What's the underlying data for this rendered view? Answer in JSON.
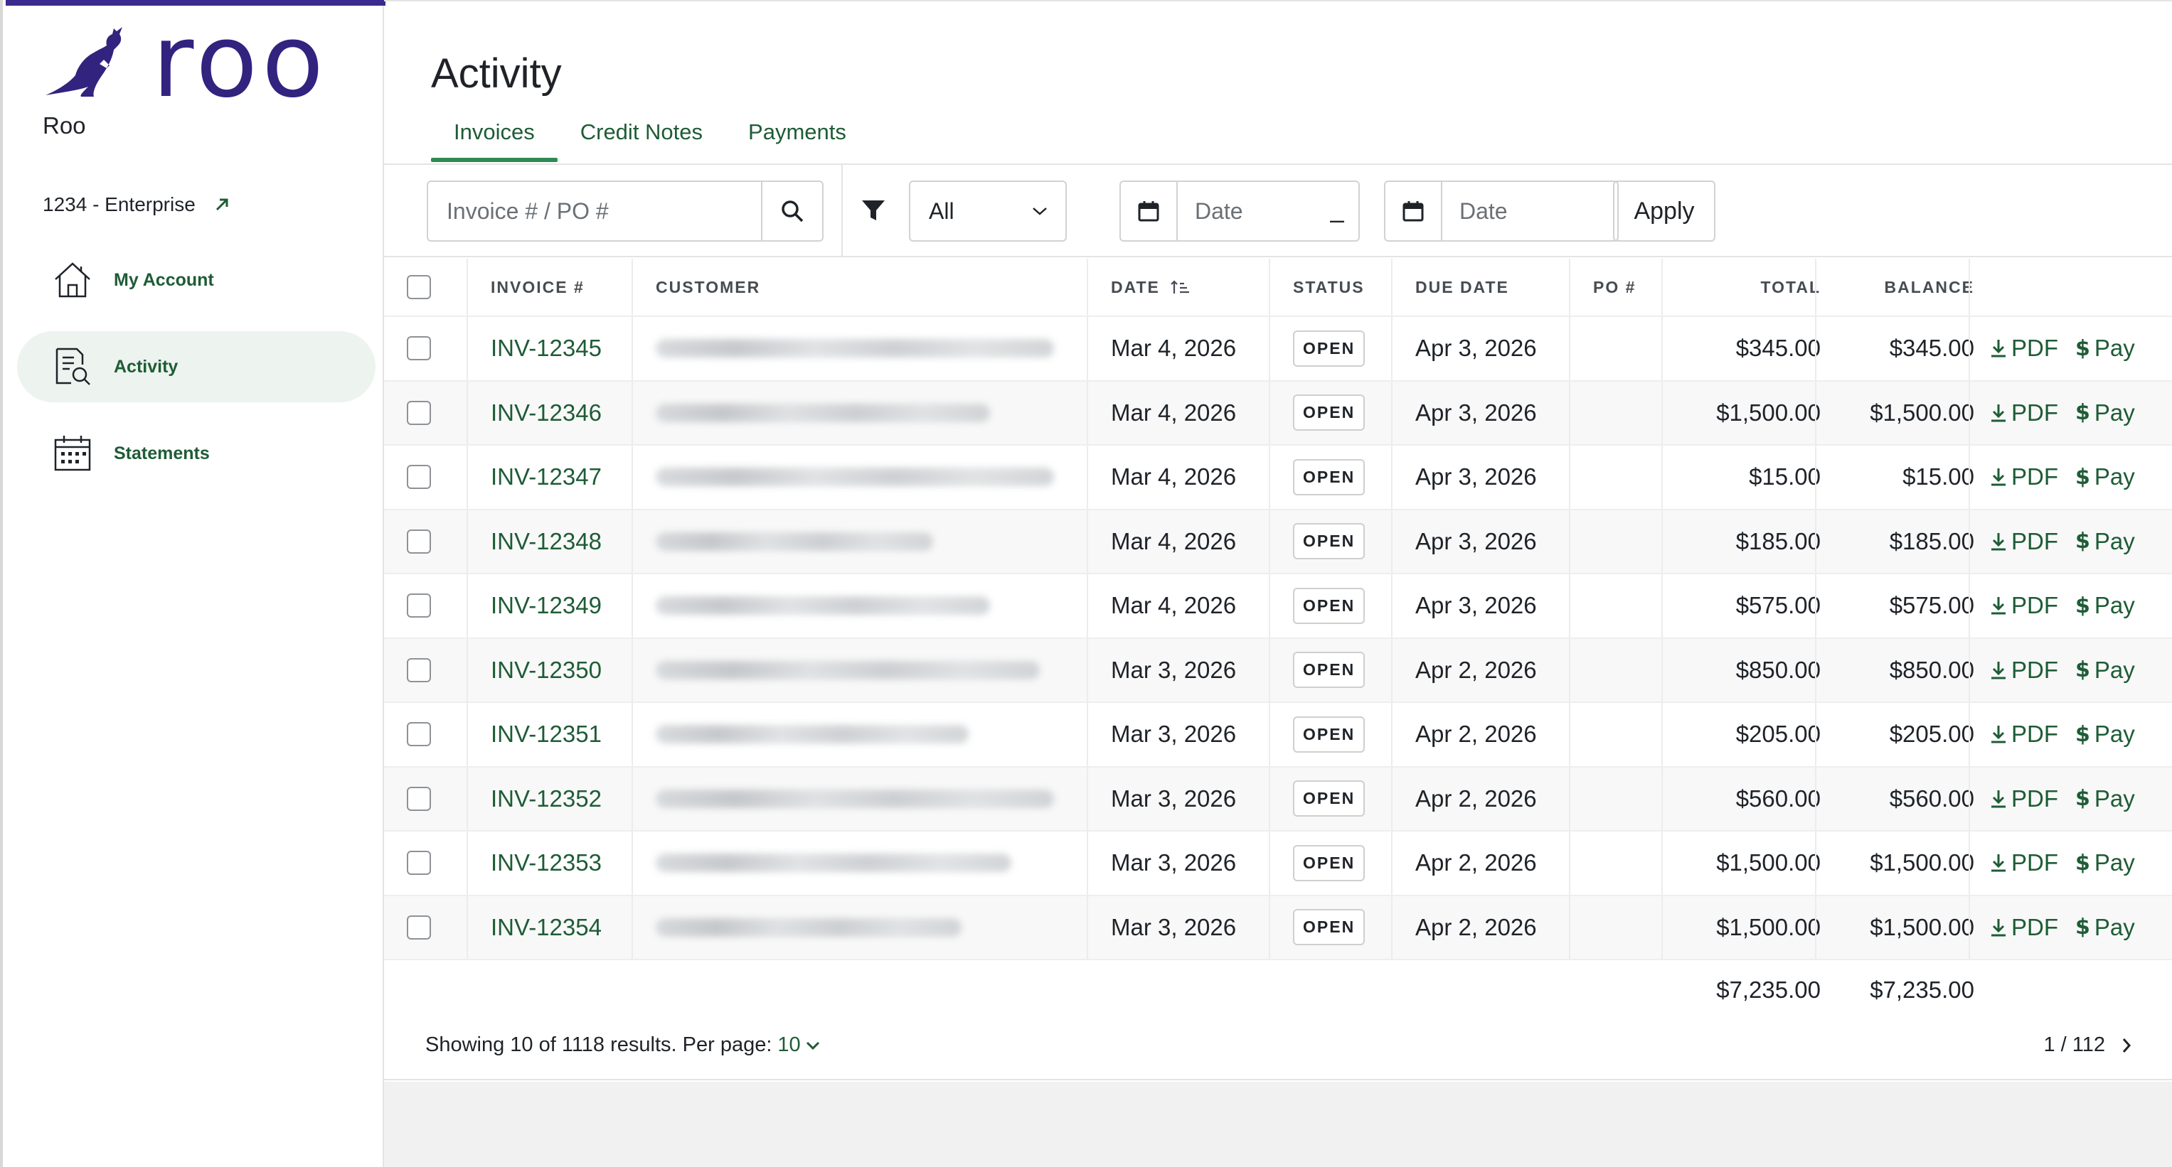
{
  "brand": {
    "logo_text": "roo",
    "org_name": "Roo",
    "account": "1234 - Enterprise",
    "accent": "#3b2a8f",
    "green": "#1e5c36"
  },
  "sidebar": {
    "items": [
      {
        "label": "My Account",
        "icon": "home-icon",
        "active": false
      },
      {
        "label": "Activity",
        "icon": "document-search-icon",
        "active": true
      },
      {
        "label": "Statements",
        "icon": "calendar-icon",
        "active": false
      }
    ]
  },
  "page": {
    "title": "Activity"
  },
  "tabs": [
    {
      "label": "Invoices",
      "active": true
    },
    {
      "label": "Credit Notes",
      "active": false
    },
    {
      "label": "Payments",
      "active": false
    }
  ],
  "filters": {
    "search_placeholder": "Invoice # / PO #",
    "status_selected": "All",
    "date_from_placeholder": "Date",
    "date_to_placeholder": "Date",
    "date_separator": "–",
    "apply_label": "Apply"
  },
  "table": {
    "headers": {
      "invoice": "INVOICE #",
      "customer": "CUSTOMER",
      "date": "DATE",
      "status": "STATUS",
      "due_date": "DUE DATE",
      "po": "PO #",
      "total": "TOTAL",
      "balance": "BALANCE"
    },
    "action_pdf": "PDF",
    "action_pay": "Pay",
    "rows": [
      {
        "invoice": "INV-12345",
        "date": "Mar 4, 2026",
        "status": "OPEN",
        "due": "Apr 3, 2026",
        "po": "",
        "total": "$345.00",
        "balance": "$345.00"
      },
      {
        "invoice": "INV-12346",
        "date": "Mar 4, 2026",
        "status": "OPEN",
        "due": "Apr 3, 2026",
        "po": "",
        "total": "$1,500.00",
        "balance": "$1,500.00"
      },
      {
        "invoice": "INV-12347",
        "date": "Mar 4, 2026",
        "status": "OPEN",
        "due": "Apr 3, 2026",
        "po": "",
        "total": "$15.00",
        "balance": "$15.00"
      },
      {
        "invoice": "INV-12348",
        "date": "Mar 4, 2026",
        "status": "OPEN",
        "due": "Apr 3, 2026",
        "po": "",
        "total": "$185.00",
        "balance": "$185.00"
      },
      {
        "invoice": "INV-12349",
        "date": "Mar 4, 2026",
        "status": "OPEN",
        "due": "Apr 3, 2026",
        "po": "",
        "total": "$575.00",
        "balance": "$575.00"
      },
      {
        "invoice": "INV-12350",
        "date": "Mar 3, 2026",
        "status": "OPEN",
        "due": "Apr 2, 2026",
        "po": "",
        "total": "$850.00",
        "balance": "$850.00"
      },
      {
        "invoice": "INV-12351",
        "date": "Mar 3, 2026",
        "status": "OPEN",
        "due": "Apr 2, 2026",
        "po": "",
        "total": "$205.00",
        "balance": "$205.00"
      },
      {
        "invoice": "INV-12352",
        "date": "Mar 3, 2026",
        "status": "OPEN",
        "due": "Apr 2, 2026",
        "po": "",
        "total": "$560.00",
        "balance": "$560.00"
      },
      {
        "invoice": "INV-12353",
        "date": "Mar 3, 2026",
        "status": "OPEN",
        "due": "Apr 2, 2026",
        "po": "",
        "total": "$1,500.00",
        "balance": "$1,500.00"
      },
      {
        "invoice": "INV-12354",
        "date": "Mar 3, 2026",
        "status": "OPEN",
        "due": "Apr 2, 2026",
        "po": "",
        "total": "$1,500.00",
        "balance": "$1,500.00"
      }
    ],
    "totals": {
      "total": "$7,235.00",
      "balance": "$7,235.00"
    }
  },
  "pagination": {
    "showing_text": "Showing 10 of 1118 results. Per page:",
    "per_page": "10",
    "page_indicator": "1 / 112"
  }
}
